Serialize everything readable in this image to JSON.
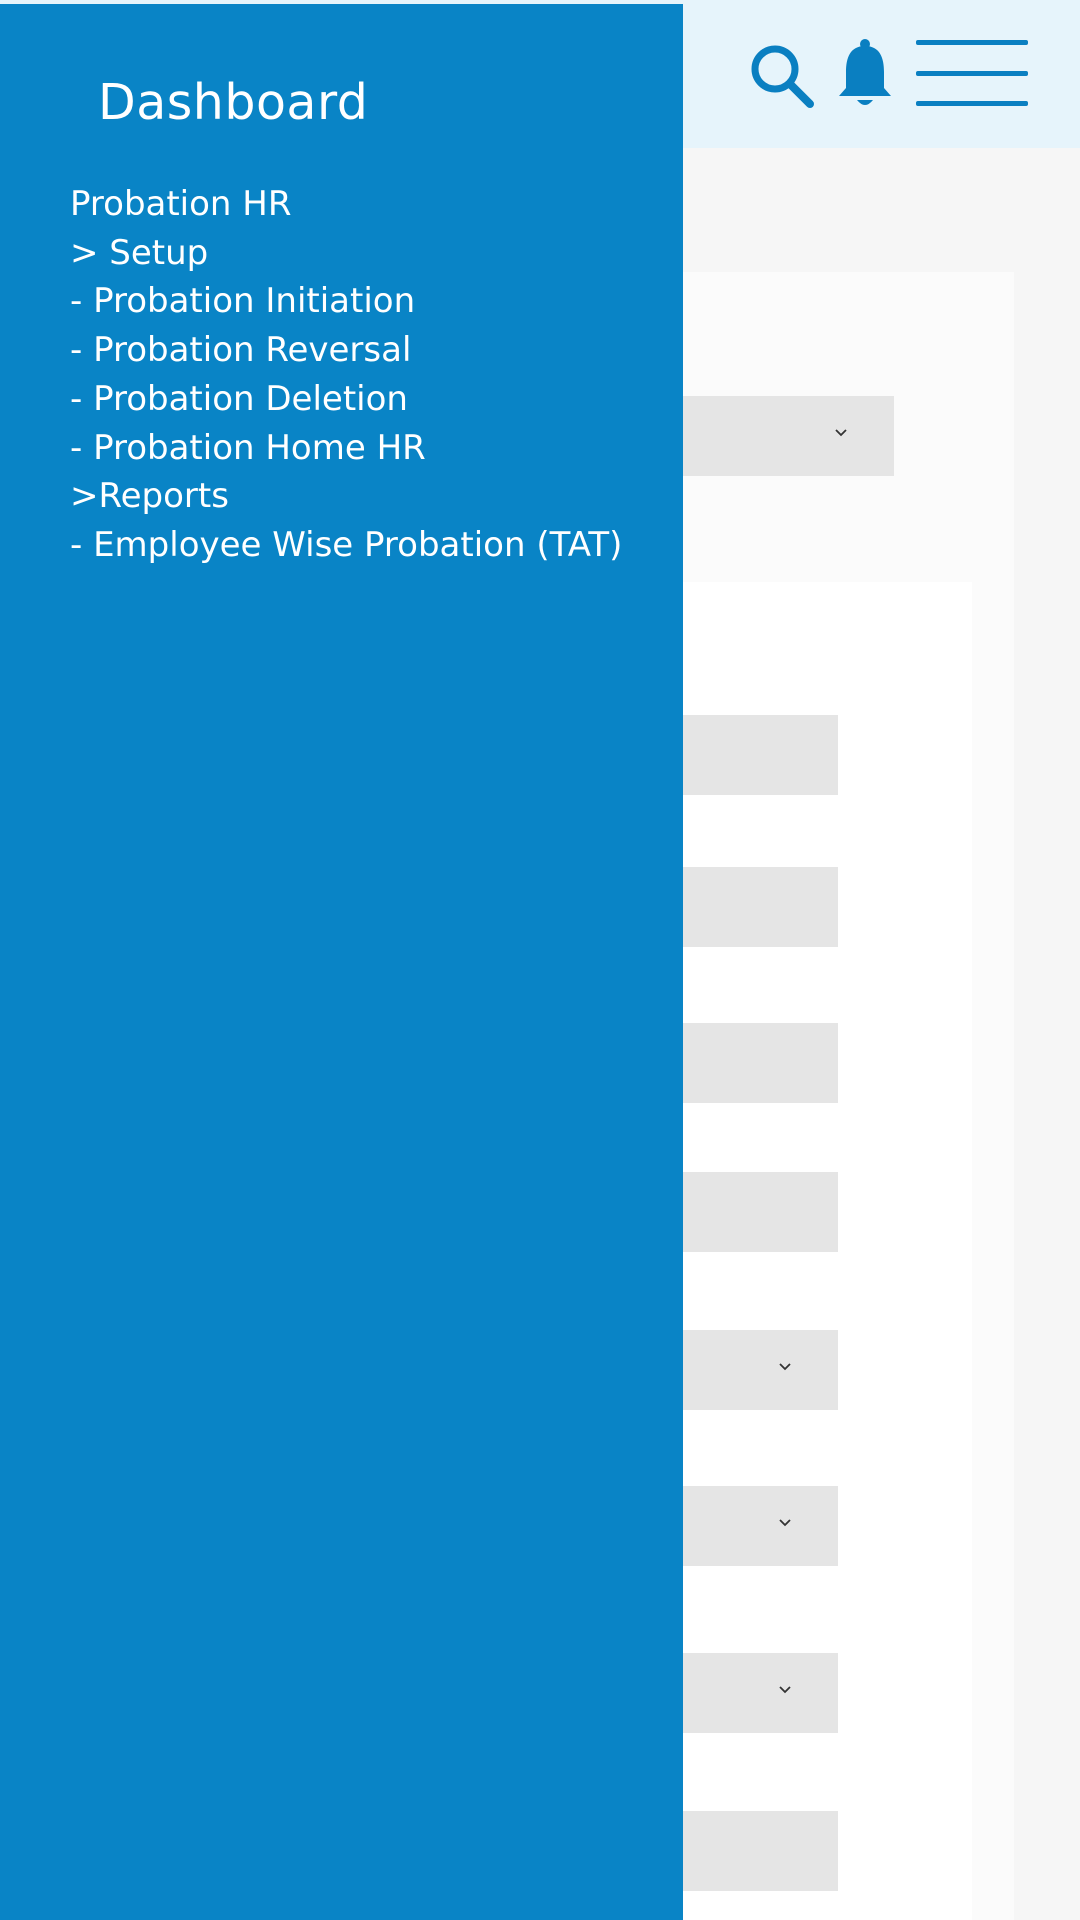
{
  "drawer": {
    "title": "Dashboard",
    "items": [
      {
        "label": "Probation HR"
      },
      {
        "label": "> Setup"
      },
      {
        "label": "- Probation Initiation"
      },
      {
        "label": "- Probation Reversal"
      },
      {
        "label": "- Probation Deletion"
      },
      {
        "label": "- Probation Home HR"
      },
      {
        "label": ">Reports"
      },
      {
        "label": "- Employee Wise Probation (TAT)"
      }
    ]
  },
  "header": {
    "icons": [
      "search-icon",
      "bell-icon",
      "hamburger-menu-icon"
    ]
  },
  "colors": {
    "drawer_bg": "#0984c6",
    "header_bg": "#e6f4fb",
    "icon": "#0a7fc1",
    "field_bg": "#e5e5e5"
  }
}
